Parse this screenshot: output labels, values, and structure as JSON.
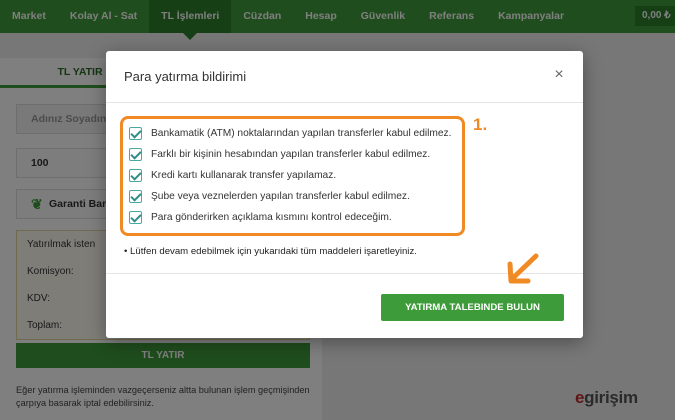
{
  "topnav": {
    "items": [
      "Market",
      "Kolay Al - Sat",
      "TL İşlemleri",
      "Cüzdan",
      "Hesap",
      "Güvenlik",
      "Referans",
      "Kampanyalar"
    ],
    "balance": "0,00 ₺"
  },
  "left_panel": {
    "tab": "TL YATIR",
    "name_placeholder": "Adınız Soyadın",
    "amount": "100",
    "bank": "Garanti Ban",
    "summary": {
      "line1": "Yatırılmak isten",
      "komisyon": "Komisyon:",
      "kdv": "KDV:",
      "toplam": "Toplam:"
    },
    "submit": "TL YATIR",
    "note": "Eğer yatırma işleminden vazgeçerseniz altta bulunan işlem geçmişinden çarpıya basarak iptal edebilirsiniz."
  },
  "modal": {
    "title": "Para yatırma bildirimi",
    "close": "×",
    "checklist": [
      "Bankamatik (ATM) noktalarından yapılan transferler kabul edilmez.",
      "Farklı bir kişinin hesabından yapılan transferler kabul edilmez.",
      "Kredi kartı kullanarak transfer yapılamaz.",
      "Şube veya veznelerden yapılan transferler kabul edilmez.",
      "Para gönderirken açıklama kısmını kontrol edeceğim."
    ],
    "step_label": "1.",
    "warning": "• Lütfen devam edebilmek için yukarıdaki tüm maddeleri işaretleyiniz.",
    "submit": "YATIRMA TALEBINDE BULUN"
  },
  "brand": {
    "e": "e",
    "rest": "girişim"
  },
  "colors": {
    "accent": "#3e9b3a",
    "highlight": "#f08a24"
  }
}
